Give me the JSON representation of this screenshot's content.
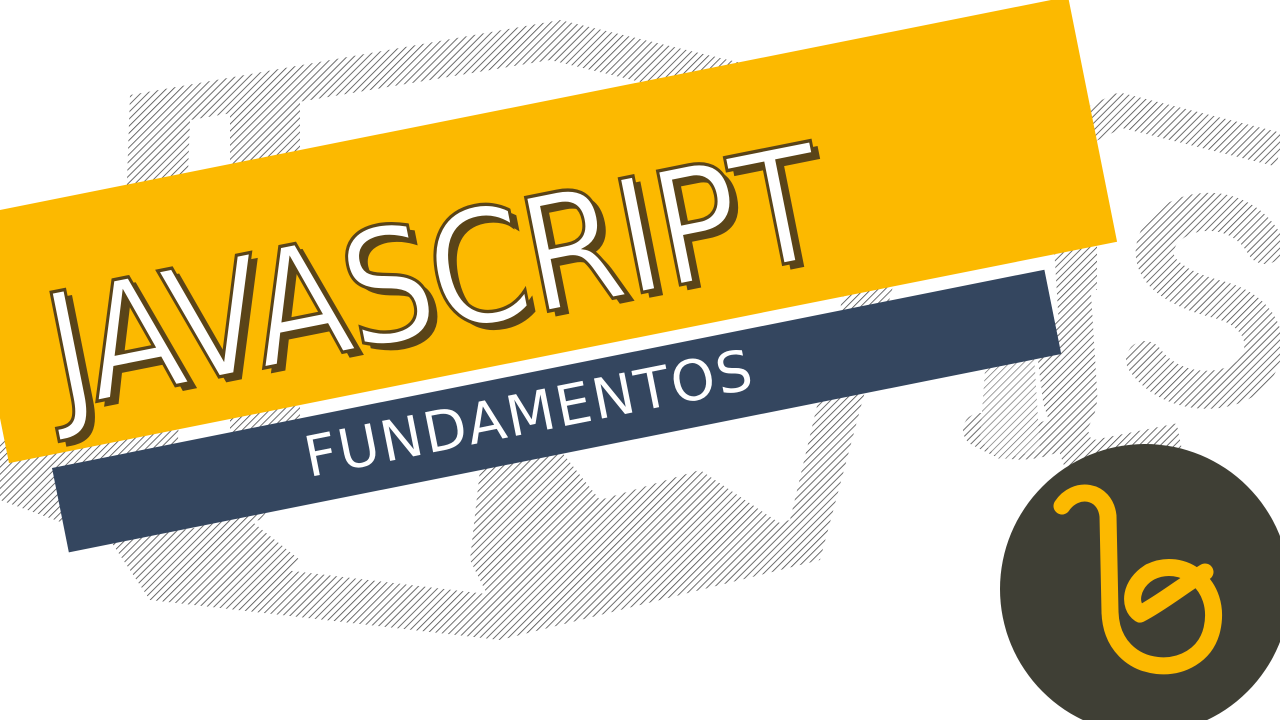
{
  "title": "JAVASCRIPT",
  "subtitle": "FUNDAMENTOS",
  "background_watermark": "JS",
  "logo": {
    "letter": "b",
    "icon": "b-brand-logo-icon"
  },
  "colors": {
    "accent_yellow": "#fcb900",
    "banner_navy": "#34465f",
    "title_outline": "#5a4418",
    "logo_circle": "#3f3f35",
    "logo_letter": "#fcb900",
    "hatch": "#4a4a4a"
  }
}
